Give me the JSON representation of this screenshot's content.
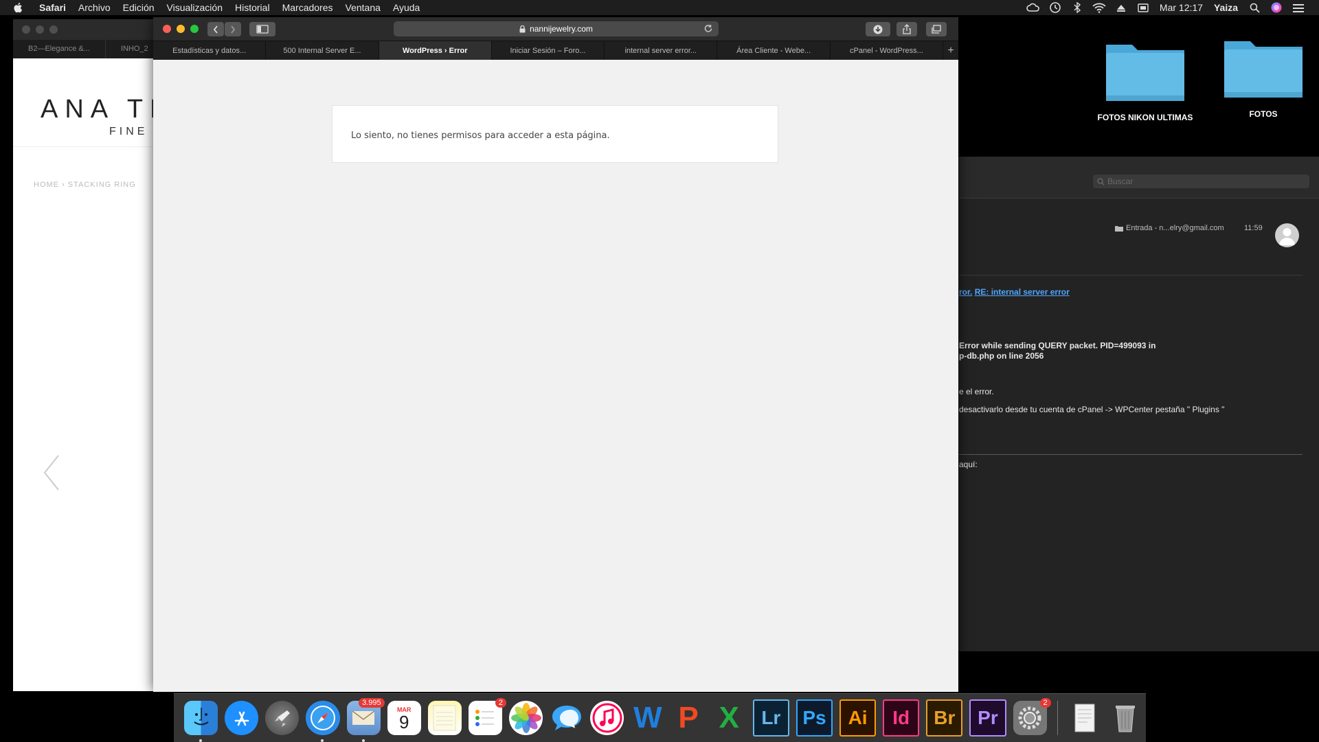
{
  "menubar": {
    "app": "Safari",
    "items": [
      "Archivo",
      "Edición",
      "Visualización",
      "Historial",
      "Marcadores",
      "Ventana",
      "Ayuda"
    ],
    "clock": "Mar 12:17",
    "user": "Yaiza"
  },
  "desktop": {
    "folders": [
      {
        "label": "FOTOS NIKON ULTIMAS"
      },
      {
        "label": "FOTOS"
      }
    ]
  },
  "background_window": {
    "tabs": [
      "B2—Elegance &...",
      "INHO_2"
    ],
    "logo": "ANA TH",
    "logo_sub": "FINE J",
    "breadcrumb": "HOME   ›   STACKING RING"
  },
  "mail": {
    "search_placeholder": "Buscar",
    "mailbox": "Entrada - n...elry@gmail.com",
    "time": "11:59",
    "link_pre": "ror.",
    "link_text": "RE: internal server error",
    "error_line1": "Error while sending QUERY packet. PID=499093 in",
    "error_line2": "p-db.php on line 2056",
    "line3": "e el error.",
    "line4": "desactivarlo desde tu cuenta de cPanel -> WPCenter pestaña \" Plugins \"",
    "line5": "aquí:"
  },
  "safari": {
    "url": "nannijewelry.com",
    "tabs": [
      {
        "label": "Estadísticas y datos...",
        "active": false
      },
      {
        "label": "500 Internal Server E...",
        "active": false
      },
      {
        "label": "WordPress › Error",
        "active": true
      },
      {
        "label": "Iniciar Sesión – Foro...",
        "active": false
      },
      {
        "label": "internal server error...",
        "active": false
      },
      {
        "label": "Área Cliente - Webe...",
        "active": false
      },
      {
        "label": "cPanel - WordPress...",
        "active": false
      }
    ],
    "new_tab": "+",
    "error_message": "Lo siento, no tienes permisos para acceder a esta página."
  },
  "dock": {
    "mail_badge": "3.995",
    "calendar_month": "MAR",
    "calendar_day": "9",
    "reminders_badge": "2",
    "prefs_badge": "2",
    "apps": [
      "Finder",
      "App Store",
      "Launchpad",
      "Safari",
      "Mail",
      "Calendar",
      "Notes",
      "Reminders",
      "Photos",
      "Messages",
      "iTunes",
      "Word",
      "PowerPoint",
      "Excel",
      "Lr",
      "Ps",
      "Ai",
      "Id",
      "Br",
      "Pr",
      "System Preferences",
      "Documents",
      "Trash"
    ]
  }
}
